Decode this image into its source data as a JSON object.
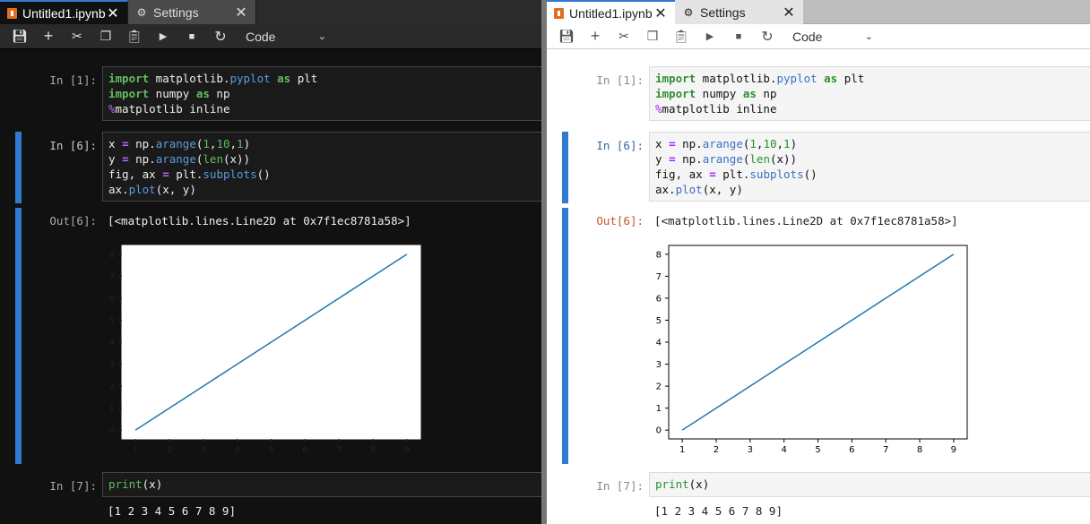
{
  "tabs": {
    "notebook": "Untitled1.ipynb",
    "settings": "Settings"
  },
  "toolbar": {
    "cell_type": "Code"
  },
  "cells": {
    "c1_prompt": "In [1]:",
    "c2_prompt": "In [6]:",
    "out_prompt": "Out[6]:",
    "out_text": "[<matplotlib.lines.Line2D at 0x7f1ec8781a58>]",
    "c3_prompt": "In [7]:",
    "c3_code": "print(x)",
    "c3_output": "[1 2 3 4 5 6 7 8 9]"
  },
  "colors": {
    "accent": "#2f7bd2",
    "line": "#1f77b4",
    "tab_icon": "#e16e1c"
  },
  "chart_data": {
    "type": "line",
    "x": [
      1,
      2,
      3,
      4,
      5,
      6,
      7,
      8,
      9
    ],
    "y": [
      0,
      1,
      2,
      3,
      4,
      5,
      6,
      7,
      8
    ],
    "xticks": [
      1,
      2,
      3,
      4,
      5,
      6,
      7,
      8,
      9
    ],
    "yticks": [
      0,
      1,
      2,
      3,
      4,
      5,
      6,
      7,
      8
    ],
    "xlim": [
      0.6,
      9.4
    ],
    "ylim": [
      -0.4,
      8.4
    ],
    "title": "",
    "xlabel": "",
    "ylabel": ""
  }
}
